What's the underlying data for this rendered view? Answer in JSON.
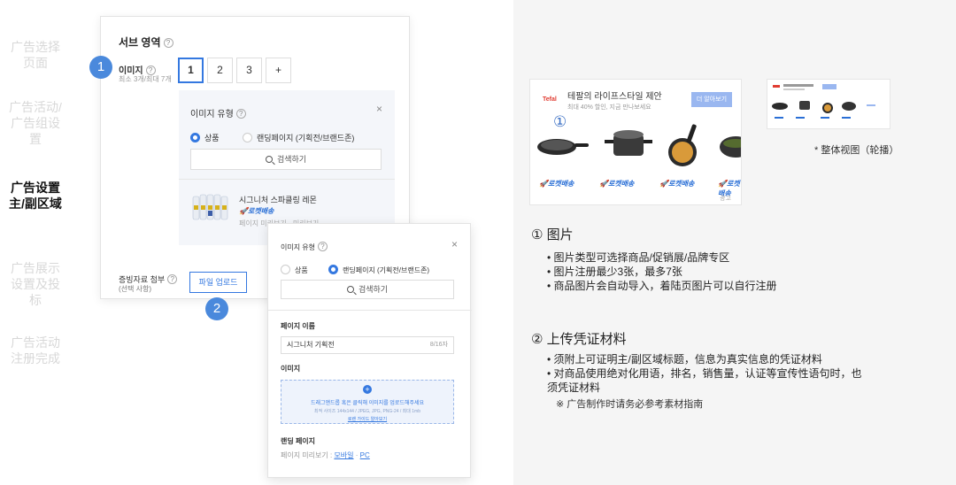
{
  "steps": [
    {
      "label": "广告选择\n页面",
      "active": false
    },
    {
      "label": "广告活动/\n广告组设\n置",
      "active": false
    },
    {
      "label": "广告设置\n主/副区域",
      "active": true
    },
    {
      "label": "广告展示\n设置及投\n标",
      "active": false
    },
    {
      "label": "广告活动\n注册完成",
      "active": false
    }
  ],
  "panel": {
    "title": "서브 영역",
    "image_label": "이미지",
    "image_sub": "최소 3개/최대 7개",
    "image_buttons": [
      "1",
      "2",
      "3",
      "+"
    ],
    "attach_label": "증빙자료 첨부",
    "attach_sub": "(선택 사항)",
    "upload_button": "파일 업로드"
  },
  "badges": {
    "one": "1",
    "two": "2"
  },
  "image_type_popup": {
    "title": "이미지 유형",
    "close": "×",
    "option_product": "상품",
    "option_landing": "랜딩페이지 (기획전/브랜드존)",
    "search": "검색하기",
    "product_name": "시그니처 스파클링 레몬",
    "rocket": "로켓배송",
    "preview": "페이지 미리보기 · 미리보기"
  },
  "dialog": {
    "title": "이미지 유형",
    "close": "×",
    "option_product": "상품",
    "option_landing": "랜딩페이지 (기획전/브랜드존)",
    "search": "검색하기",
    "page_name_label": "페이지 이름",
    "page_name_value": "시그니처 기획전",
    "page_name_count": "8/16자",
    "image_label": "이미지",
    "drop_plus": "+",
    "drop_text": "드래그앤드롭 혹은 클릭해 이미지를 업로드해주세요",
    "drop_spec": "최적 사이즈 144x144 / JPEG, JPG, PNG-24 / 최대 1mb",
    "drop_guide": "로렌 가이드 알아보기",
    "landing_label": "랜딩 페이지",
    "landing_preview": "페이지 미리보기 :",
    "landing_mobile": "모바일",
    "landing_sep": "·",
    "landing_pc": "PC"
  },
  "ad": {
    "brand": "Tefal",
    "headline": "테팔의 라이프스타일 제안",
    "subline": "최대 40% 할인, 지금 만나보세요",
    "cta": "더 알아보기",
    "marker": "①",
    "rocket": "로켓배송",
    "ad_tag": "광고"
  },
  "overall_view": "* 整体视图（轮播）",
  "section1": {
    "title": "① 图片",
    "bullets": [
      "• 图片类型可选择商品/促销展/品牌专区",
      "• 图片注册最少3张，最多7张",
      "• 商品图片会自动导入，着陆页图片可以自行注册"
    ]
  },
  "section2": {
    "title": "② 上传凭证材料",
    "lines": [
      "• 须附上可证明主/副区域标题，信息为真实信息的凭证材料",
      "• 对商品使用绝对化用语，排名，销售量，认证等宣传性语句时，也",
      "须凭证材料"
    ],
    "note": "※ 广告制作时请务必参考素材指南"
  }
}
